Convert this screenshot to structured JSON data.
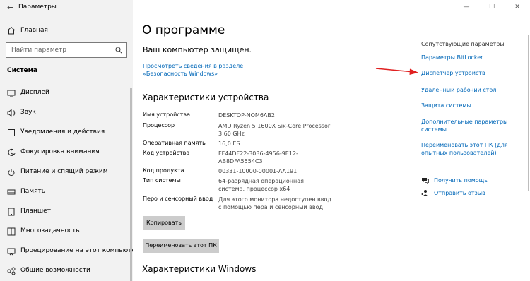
{
  "window": {
    "title": "Параметры",
    "controls": [
      "—",
      "☐",
      "✕"
    ]
  },
  "sidebar": {
    "home_label": "Главная",
    "search_placeholder": "Найти параметр",
    "section_title": "Система",
    "items": [
      {
        "label": "Дисплей",
        "icon": "display-icon"
      },
      {
        "label": "Звук",
        "icon": "sound-icon"
      },
      {
        "label": "Уведомления и действия",
        "icon": "notifications-icon"
      },
      {
        "label": "Фокусировка внимания",
        "icon": "focus-icon"
      },
      {
        "label": "Питание и спящий режим",
        "icon": "power-icon"
      },
      {
        "label": "Память",
        "icon": "storage-icon"
      },
      {
        "label": "Планшет",
        "icon": "tablet-icon"
      },
      {
        "label": "Многозадачность",
        "icon": "multitasking-icon"
      },
      {
        "label": "Проецирование на этот компьютер",
        "icon": "projecting-icon"
      },
      {
        "label": "Общие возможности",
        "icon": "shared-icon"
      }
    ]
  },
  "main": {
    "title": "О программе",
    "protected_text": "Ваш компьютер защищен.",
    "security_link": "Просмотреть сведения в разделе «Безопасность Windows»",
    "device_specs_title": "Характеристики устройства",
    "specs": [
      {
        "key": "Имя устройства",
        "value": "DESKTOP-NOM6AB2"
      },
      {
        "key": "Процессор",
        "value": "AMD Ryzen 5 1600X Six-Core Processor 3.60 GHz"
      },
      {
        "key": "Оперативная память",
        "value": "16,0 ГБ"
      },
      {
        "key": "Код устройства",
        "value": "FF44DF22-3036-4956-9E12-AB8DFA5554C3"
      },
      {
        "key": "Код продукта",
        "value": "00331-10000-00001-AA191"
      },
      {
        "key": "Тип системы",
        "value": "64-разрядная операционная система, процессор x64"
      },
      {
        "key": "Перо и сенсорный ввод",
        "value": "Для этого монитора недоступен ввод с помощью пера и сенсорный ввод"
      }
    ],
    "copy_button": "Копировать",
    "rename_button": "Переименовать этот ПК",
    "windows_specs_title": "Характеристики Windows"
  },
  "related": {
    "title": "Сопутствующие параметры",
    "links": [
      "Параметры BitLocker",
      "Диспетчер устройств",
      "Удаленный рабочий стол",
      "Защита системы",
      "Дополнительные параметры системы",
      "Переименовать этот ПК (для опытных пользователей)"
    ],
    "help": [
      {
        "label": "Получить помощь",
        "icon": "help-chat-icon"
      },
      {
        "label": "Отправить отзыв",
        "icon": "feedback-icon"
      }
    ]
  },
  "colors": {
    "link": "#0067b8",
    "sidebar_bg": "#f2f2f2",
    "arrow": "#e02020"
  }
}
